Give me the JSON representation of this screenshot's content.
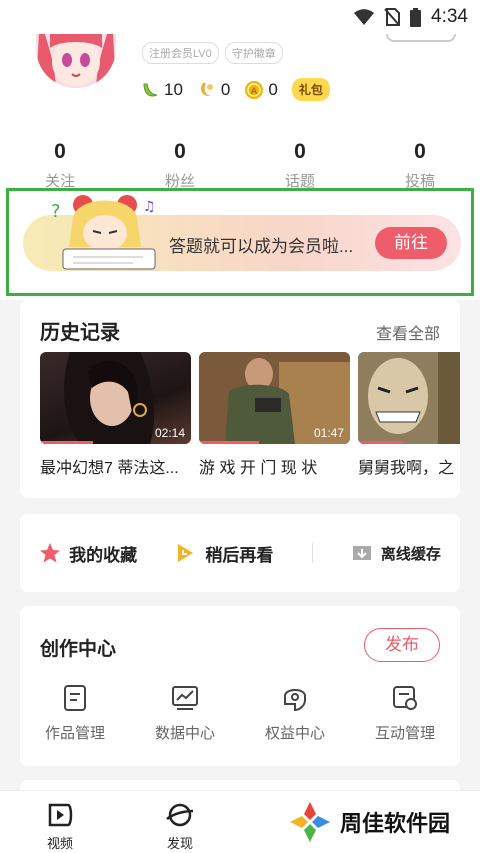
{
  "status": {
    "time": "4:34"
  },
  "profile": {
    "badges": [
      "注册会员LV0",
      "守护徽章"
    ],
    "coins": [
      {
        "icon": "banana-icon",
        "value": "10",
        "color": "#6dbb2c"
      },
      {
        "icon": "moon-coin-icon",
        "value": "0",
        "color": "#f2a93b"
      },
      {
        "icon": "gold-coin-icon",
        "value": "0",
        "color": "#f4b400"
      }
    ],
    "gift_label": "礼包"
  },
  "stats": [
    {
      "value": "0",
      "label": "关注"
    },
    {
      "value": "0",
      "label": "粉丝"
    },
    {
      "value": "0",
      "label": "话题"
    },
    {
      "value": "0",
      "label": "投稿"
    }
  ],
  "promo": {
    "text": "答题就可以成为会员啦...",
    "button": "前往"
  },
  "history": {
    "title": "历史记录",
    "view_all": "查看全部",
    "videos": [
      {
        "title": "最冲幻想7 蒂法这...",
        "duration": "02:14",
        "progress": 0.35
      },
      {
        "title": "游 戏 开 门 现 状",
        "duration": "01:47",
        "progress": 0.4
      },
      {
        "title": "舅舅我啊，之",
        "duration": "",
        "progress": 0.3
      }
    ]
  },
  "quick": [
    {
      "label": "我的收藏",
      "icon": "star-icon",
      "color": "#ef5d6a"
    },
    {
      "label": "稍后再看",
      "icon": "clock-icon",
      "color": "#f5b323"
    },
    {
      "label": "离线缓存",
      "icon": "download-icon",
      "color": "#999999"
    }
  ],
  "creator": {
    "title": "创作中心",
    "publish": "发布",
    "tools": [
      {
        "label": "作品管理",
        "icon": "works-icon"
      },
      {
        "label": "数据中心",
        "icon": "chart-icon"
      },
      {
        "label": "权益中心",
        "icon": "rights-icon"
      },
      {
        "label": "互动管理",
        "icon": "interaction-icon"
      }
    ]
  },
  "tabs": [
    {
      "label": "视频",
      "icon": "video-play-icon"
    },
    {
      "label": "发现",
      "icon": "planet-icon"
    }
  ],
  "watermark": "周佳软件园",
  "colors": {
    "accent": "#ef5d6a",
    "highlight_border": "#3cb043"
  }
}
